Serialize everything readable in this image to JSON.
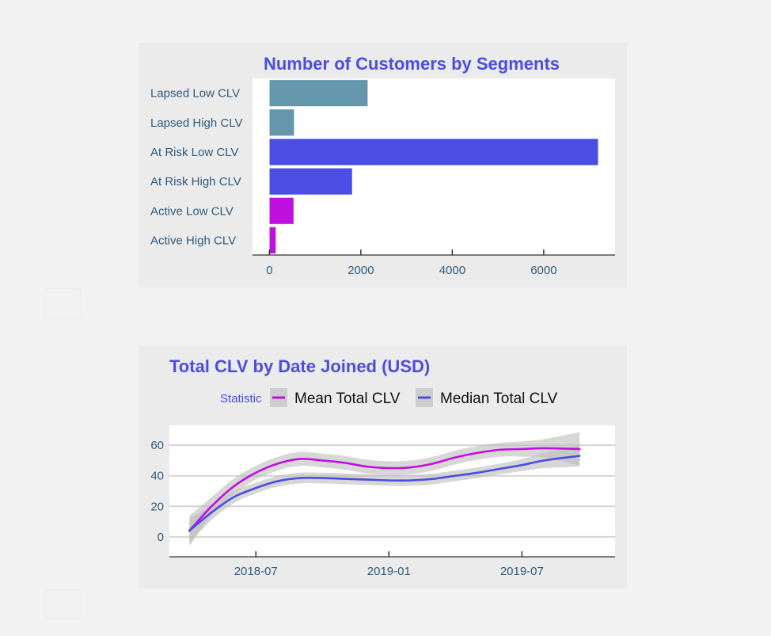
{
  "colors": {
    "title": "#4b4de3",
    "axis_text": "#2f5a7e",
    "lapsed": "#6497ab",
    "at_risk": "#4b4de3",
    "active": "#c010e0",
    "mean": "#c010e0",
    "median": "#4b4de3",
    "ribbon": "#bdbdbd",
    "panel_bg": "#ebebeb",
    "plot_bg": "#ffffff",
    "grid": "#d4d4d4"
  },
  "chart_data": [
    {
      "type": "bar",
      "orientation": "horizontal",
      "title": "Number of Customers by Segments",
      "xlabel": "",
      "ylabel": "",
      "categories": [
        "Lapsed Low CLV",
        "Lapsed High CLV",
        "At Risk Low CLV",
        "At Risk High CLV",
        "Active Low CLV",
        "Active High CLV"
      ],
      "values": [
        2150,
        540,
        7190,
        1810,
        530,
        140
      ],
      "bar_groups": [
        "lapsed",
        "lapsed",
        "at_risk",
        "at_risk",
        "active",
        "active"
      ],
      "xticks": [
        0,
        2000,
        4000,
        6000
      ],
      "xtick_labels": [
        "0",
        "2000",
        "4000",
        "6000"
      ],
      "xlim": [
        -370,
        7560
      ],
      "grid": false,
      "legend": "none"
    },
    {
      "type": "line",
      "title": "Total CLV by Date Joined (USD)",
      "xlabel": "",
      "ylabel": "",
      "x": [
        "2018-04",
        "2018-05",
        "2018-06",
        "2018-07",
        "2018-08",
        "2018-09",
        "2018-10",
        "2018-11",
        "2018-12",
        "2019-01",
        "2019-02",
        "2019-03",
        "2019-04",
        "2019-05",
        "2019-06",
        "2019-07",
        "2019-08",
        "2019-09"
      ],
      "x_month_index": [
        0,
        1,
        2,
        3,
        4,
        5,
        6,
        7,
        8,
        9,
        10,
        11,
        12,
        13,
        14,
        15,
        16,
        17.6
      ],
      "series": [
        {
          "name": "Mean Total CLV",
          "color_key": "mean",
          "values": [
            4,
            20,
            33,
            42,
            48,
            51,
            50,
            48.5,
            46,
            45,
            45.5,
            48,
            52,
            55,
            57,
            57.5,
            58,
            57.5
          ],
          "ci_halfwidth": [
            10,
            6,
            5,
            4.5,
            4.5,
            4.5,
            4.5,
            4.5,
            4.5,
            4.5,
            4.5,
            4.5,
            4.5,
            4.5,
            4.5,
            5,
            6,
            11
          ]
        },
        {
          "name": "Median Total CLV",
          "color_key": "median",
          "values": [
            4,
            16,
            26,
            32,
            36.5,
            38.5,
            38.5,
            38,
            37.5,
            37,
            37,
            38,
            40,
            42,
            44.5,
            47,
            50,
            53
          ],
          "ci_halfwidth": [
            8,
            5,
            4,
            3.5,
            3.5,
            3.5,
            3.5,
            3.5,
            3.5,
            3.5,
            3.5,
            3.5,
            3.5,
            3.5,
            3.5,
            4,
            5,
            7
          ]
        }
      ],
      "yticks": [
        0,
        20,
        40,
        60
      ],
      "ytick_labels": [
        "0",
        "20",
        "40",
        "60"
      ],
      "ylim": [
        -13,
        73
      ],
      "xticks_month_index": [
        3,
        9,
        15
      ],
      "xtick_labels": [
        "2018-07",
        "2019-01",
        "2019-07"
      ],
      "xlim_month_index": [
        -0.9,
        19.2
      ],
      "grid": true,
      "legend": {
        "position": "top",
        "title": "Statistic",
        "entries": [
          "Mean Total CLV",
          "Median Total CLV"
        ]
      }
    }
  ]
}
